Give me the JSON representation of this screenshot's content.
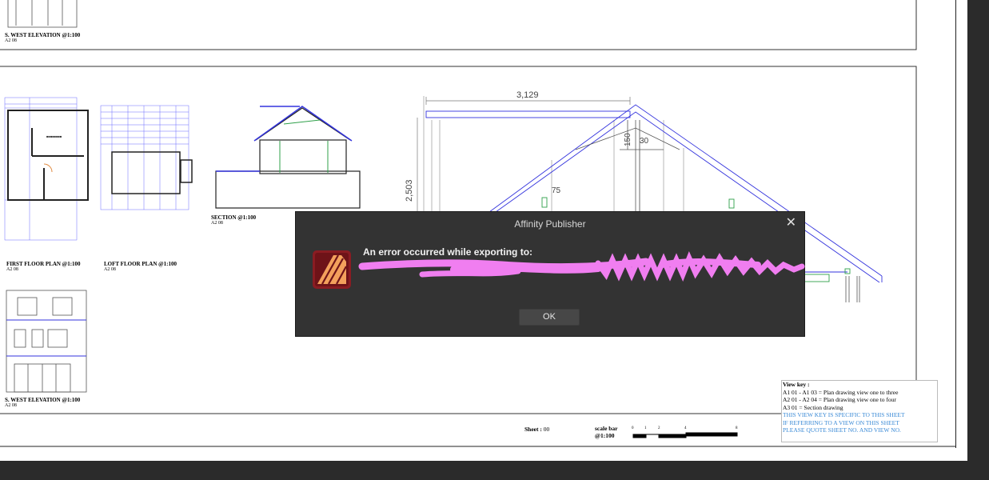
{
  "sheet": {
    "labels": {
      "top_elevation": "S. WEST ELEVATION @1:100",
      "top_elevation_ref": "A2 08",
      "first_floor": "FIRST FLOOR PLAN @1:100",
      "first_floor_ref": "A2 08",
      "loft_floor": "LOFT FLOOR PLAN @1:100",
      "loft_floor_ref": "A2 08",
      "section": "SECTION @1:100",
      "section_ref": "A2 08",
      "bottom_elevation": "S. WEST ELEVATION @1:100",
      "bottom_elevation_ref": "A2 08"
    },
    "dimensions": {
      "width_dim": "3,129",
      "height_dim": "2,503",
      "dim_150": "150",
      "dim_30": "30",
      "dim_75": "75"
    },
    "sheet_label": "Sheet :",
    "sheet_number": "00",
    "scale_bar": {
      "title": "scale bar",
      "scale": "@1:100",
      "ticks": [
        "0",
        "1",
        "2",
        "4",
        "8"
      ]
    },
    "view_key": {
      "title": "View key :",
      "lines": [
        "A1 01 - A1 03 = Plan drawing view one to three",
        "A2 01 - A2 04 =  Plan drawing view one to four",
        "A3 01              = Section drawing"
      ],
      "notes": [
        "THIS VIEW KEY IS SPECIFIC TO THIS SHEET",
        "IF REFERRING TO A VIEW ON THIS SHEET",
        "PLEASE QUOTE SHEET NO. AND VIEW NO."
      ]
    }
  },
  "dialog": {
    "title": "Affinity Publisher",
    "message": "An error occurred while exporting to:",
    "path_redacted": true,
    "ok_label": "OK",
    "icon": "affinity-publisher-app-icon",
    "colors": {
      "background": "#333333",
      "redaction": "#f07ef0",
      "icon_bg": "#8a1c22",
      "icon_fg": "#f3a05c"
    }
  }
}
